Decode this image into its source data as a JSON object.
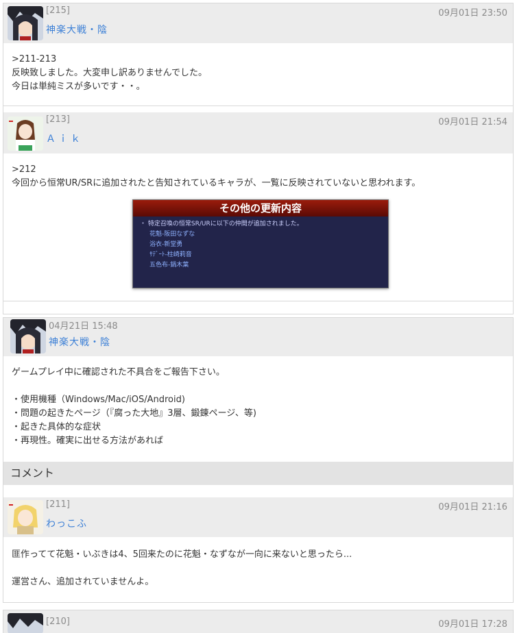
{
  "comment_215": {
    "number": "[215]",
    "name": "神楽大戦・陰",
    "date": "09月01日 23:50",
    "lines": [
      ">211-213",
      "反映致しました。大変申し訳ありませんでした。",
      "今日は単純ミスが多いです・・。"
    ]
  },
  "comment_213": {
    "number": "[213]",
    "name": "Ａｉｋ",
    "date": "09月01日 21:54",
    "lines": [
      ">212",
      "今回から恒常UR/SRに追加されたと告知されているキャラが、一覧に反映されていないと思われます。"
    ],
    "notice": {
      "title": "その他の更新内容",
      "intro": "・ 特定召喚の恒常SR/URに以下の仲間が追加されました。",
      "items": [
        "花魁-阪田なずな",
        "浴衣-新堂勇",
        "ｻﾃﾞｰﾄ-柱崎莉音",
        "五色布-鍋木葉"
      ]
    }
  },
  "post": {
    "date": "04月21日 15:48",
    "name": "神楽大戦・陰",
    "intro": "ゲームプレイ中に確認された不具合をご報告下さい。",
    "bullets": [
      "・使用機種（Windows/Mac/iOS/Android)",
      "・問題の起きたページ（『腐った大地』3層、鍛錬ページ、等)",
      "・起きた具体的な症状",
      "・再現性。確実に出せる方法があれば"
    ],
    "section_label": "コメント"
  },
  "comment_211": {
    "number": "[211]",
    "name": "わっこふ",
    "date": "09月01日 21:16",
    "lines": [
      "匪作ってて花魁・いぶきは4、5回来たのに花魁・なずなが一向に来ないと思ったら...",
      "運営さん、追加されていませんよ。"
    ]
  },
  "comment_210": {
    "number": "[210]",
    "date": "09月01日 17:28"
  },
  "colors": {
    "name": "#3b7fd6",
    "meta": "#8a8a8a",
    "header_bg": "#ececec"
  }
}
